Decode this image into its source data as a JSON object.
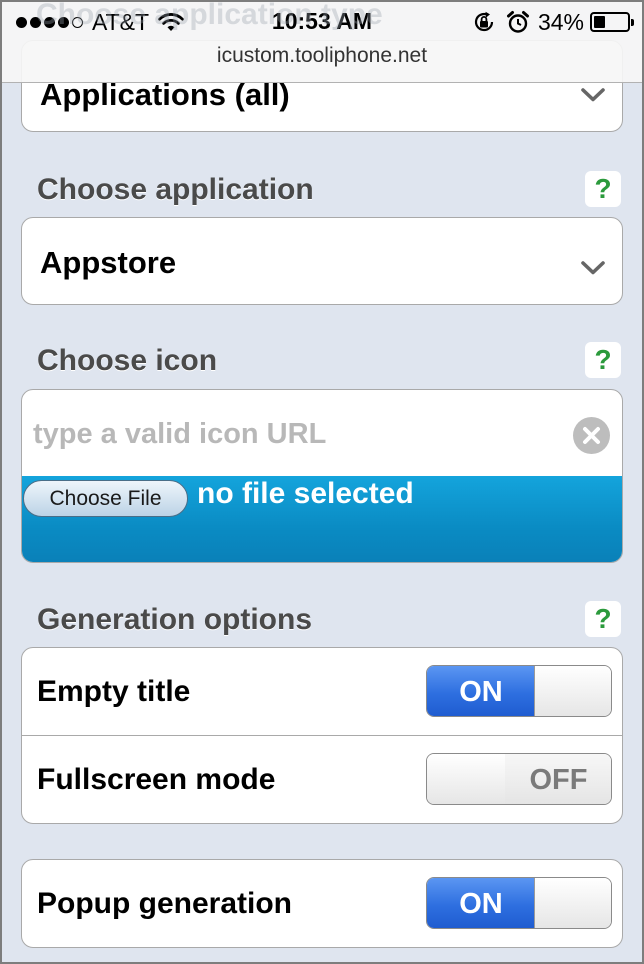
{
  "status_bar": {
    "carrier": "AT&T",
    "time": "10:53 AM",
    "battery_percent": "34%",
    "battery_level": 0.34,
    "signal_bars_filled": 4,
    "signal_bars_total": 5,
    "icons": [
      "wifi-icon",
      "orientation-lock-icon",
      "alarm-icon",
      "battery-icon"
    ]
  },
  "browser": {
    "url": "icustom.tooliphone.net"
  },
  "header": {
    "ghost_title": "Choose application type"
  },
  "form": {
    "app_type_select": {
      "value": "Applications (all)"
    },
    "choose_application": {
      "label": "Choose application",
      "help": "?",
      "select_value": "Appstore"
    },
    "choose_icon": {
      "label": "Choose icon",
      "help": "?",
      "input_placeholder": "type a valid icon URL",
      "input_value": "",
      "file_button_label": "Choose File",
      "file_status": "no file selected"
    },
    "generation_options": {
      "label": "Generation options",
      "help": "?",
      "items": [
        {
          "label": "Empty title",
          "state": "ON",
          "on": true
        },
        {
          "label": "Fullscreen mode",
          "state": "OFF",
          "on": false
        }
      ]
    },
    "popup": {
      "label": "Popup generation",
      "state": "ON",
      "on": true
    }
  },
  "colors": {
    "page_background": "#dfe5ef",
    "toggle_on": "#2e6fe0",
    "help_mark": "#2b9a3c",
    "upload_area": "#0a8bc3",
    "label_text": "#4a4a4a"
  }
}
